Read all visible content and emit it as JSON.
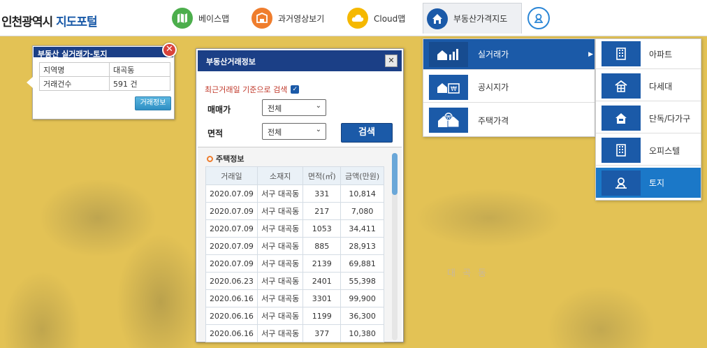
{
  "header": {
    "logo_city": "인천광역시",
    "logo_portal": "지도포털",
    "menu": [
      {
        "label": "베이스맵",
        "icon": "map-icon"
      },
      {
        "label": "과거영상보기",
        "icon": "aerial-icon"
      },
      {
        "label": "Cloud맵",
        "icon": "cloud-icon"
      },
      {
        "label": "부동산가격지도",
        "icon": "house-icon"
      },
      {
        "label": "",
        "icon": "location-pin-icon"
      }
    ]
  },
  "map": {
    "area_label": "대 곡 동"
  },
  "info_popup": {
    "title": "부동산 실거래가-토지",
    "close": "✕",
    "rows": [
      {
        "label": "지역명",
        "value": "대곡동"
      },
      {
        "label": "거래건수",
        "value": "591 건"
      }
    ],
    "detail_button": "거래정보"
  },
  "tx_panel": {
    "title": "부동산거래정보",
    "close": "✕",
    "recent_checkbox_label": "최근거래일 기준으로 검색",
    "recent_checked": true,
    "sale_label": "매매가",
    "sale_value": "전체",
    "area_label": "면적",
    "area_value": "전체",
    "search_button": "검색",
    "house_section_title": "주택정보",
    "columns": [
      "거래일",
      "소재지",
      "면적(㎡)",
      "금액(만원)"
    ],
    "rows": [
      [
        "2020.07.09",
        "서구 대곡동",
        "331",
        "10,814"
      ],
      [
        "2020.07.09",
        "서구 대곡동",
        "217",
        "7,080"
      ],
      [
        "2020.07.09",
        "서구 대곡동",
        "1053",
        "34,411"
      ],
      [
        "2020.07.09",
        "서구 대곡동",
        "885",
        "28,913"
      ],
      [
        "2020.07.09",
        "서구 대곡동",
        "2139",
        "69,881"
      ],
      [
        "2020.06.23",
        "서구 대곡동",
        "2401",
        "55,398"
      ],
      [
        "2020.06.16",
        "서구 대곡동",
        "3301",
        "99,900"
      ],
      [
        "2020.06.16",
        "서구 대곡동",
        "1199",
        "36,300"
      ],
      [
        "2020.06.16",
        "서구 대곡동",
        "377",
        "10,380"
      ]
    ]
  },
  "menu_main": [
    {
      "label": "실거래가",
      "icon": "house-chart-icon",
      "active": true
    },
    {
      "label": "공시지가",
      "icon": "house-won-icon",
      "active": false
    },
    {
      "label": "주택가격",
      "icon": "house-price-icon",
      "active": false
    }
  ],
  "menu_sub": [
    {
      "label": "아파트",
      "icon": "apartment-icon",
      "active": false
    },
    {
      "label": "다세대",
      "icon": "multiplex-icon",
      "active": false
    },
    {
      "label": "단독/다가구",
      "icon": "detached-house-icon",
      "active": false
    },
    {
      "label": "오피스텔",
      "icon": "officetel-icon",
      "active": false
    },
    {
      "label": "토지",
      "icon": "land-icon",
      "active": true
    }
  ]
}
